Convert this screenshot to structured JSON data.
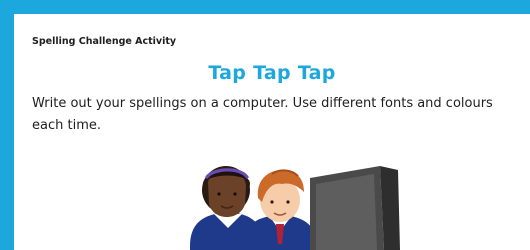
{
  "activity": {
    "label": "Spelling Challenge Activity",
    "title": "Tap Tap Tap",
    "instructions": "Write out your spellings on a computer. Use different fonts and colours each time."
  },
  "colors": {
    "border": "#1ca8dd",
    "title": "#1ca8dd",
    "text": "#1e1e1e",
    "uniform": "#1f3a8a",
    "monitor": "#4a4a4a"
  },
  "illustration": {
    "icon": "children-at-computer-illustration"
  }
}
